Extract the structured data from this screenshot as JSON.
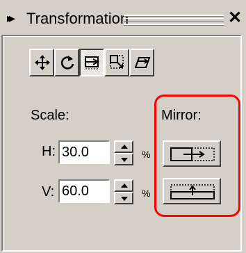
{
  "window": {
    "title": "Transformation",
    "collapse_icon": "double-chevron-right-icon",
    "close_icon": "close-icon"
  },
  "toolbar": {
    "tools": [
      {
        "name": "position-tool",
        "icon": "move-arrows-icon",
        "pressed": false
      },
      {
        "name": "rotate-tool",
        "icon": "rotate-icon",
        "pressed": false
      },
      {
        "name": "scale-mirror-tool",
        "icon": "scale-mirror-icon",
        "pressed": true
      },
      {
        "name": "size-tool",
        "icon": "size-icon",
        "pressed": false
      },
      {
        "name": "skew-tool",
        "icon": "skew-icon",
        "pressed": false
      }
    ]
  },
  "scale": {
    "label": "Scale:",
    "h_label": "H:",
    "h_value": "30.0",
    "v_label": "V:",
    "v_value": "60.0",
    "unit": "%"
  },
  "mirror": {
    "label": "Mirror:",
    "horizontal_icon": "mirror-horizontal-icon",
    "vertical_icon": "mirror-vertical-icon"
  },
  "colors": {
    "face": "#d4d0c8",
    "highlight_ring": "#ff0000"
  }
}
